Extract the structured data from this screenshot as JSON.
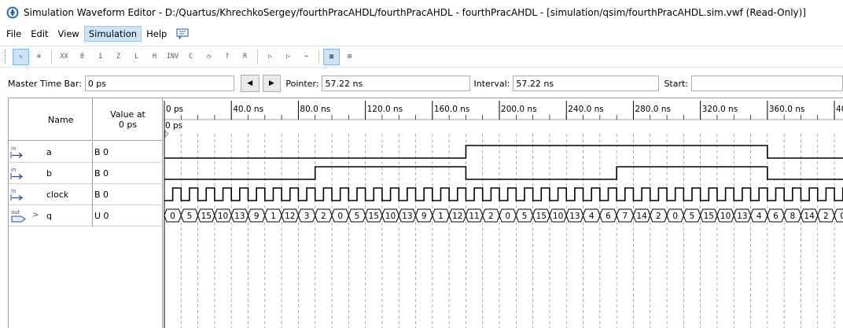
{
  "window": {
    "title": "Simulation Waveform Editor - D:/Quartus/KhrechkoSergey/fourthPracAHDL/fourthPracAHDL - fourthPracAHDL - [simulation/qsim/fourthPracAHDL.sim.vwf (Read-Only)]"
  },
  "menu": {
    "items": [
      "File",
      "Edit",
      "View",
      "Simulation",
      "Help"
    ],
    "active": "Simulation"
  },
  "toolbar": {
    "buttons": [
      {
        "icon": "selection-pointer-icon",
        "glyph": "↖",
        "pressed": true
      },
      {
        "icon": "zoom-icon",
        "glyph": "⊕",
        "pressed": false
      },
      {
        "sep": true
      },
      {
        "icon": "force-unknown-icon",
        "glyph": "XX",
        "pressed": false
      },
      {
        "icon": "force-low-icon",
        "glyph": "0",
        "pressed": false
      },
      {
        "icon": "force-high-icon",
        "glyph": "1",
        "pressed": false
      },
      {
        "icon": "force-high-impedance-icon",
        "glyph": "Z",
        "pressed": false
      },
      {
        "icon": "force-weak-low-icon",
        "glyph": "L",
        "pressed": false
      },
      {
        "icon": "force-weak-high-icon",
        "glyph": "H",
        "pressed": false
      },
      {
        "icon": "invert-icon",
        "glyph": "INV",
        "pressed": false
      },
      {
        "icon": "count-value-icon",
        "glyph": "C",
        "pressed": false
      },
      {
        "icon": "overwrite-clock-icon",
        "glyph": "◷",
        "pressed": false
      },
      {
        "icon": "arbitrary-value-icon",
        "glyph": "?",
        "pressed": false
      },
      {
        "icon": "random-values-icon",
        "glyph": "R",
        "pressed": false
      },
      {
        "sep": true
      },
      {
        "icon": "run-functional-simulation-icon",
        "glyph": "▷",
        "pressed": false
      },
      {
        "icon": "run-timing-simulation-icon",
        "glyph": "▷",
        "pressed": false
      },
      {
        "icon": "generate-netlist-icon",
        "glyph": "⋯",
        "pressed": false
      },
      {
        "sep": true
      },
      {
        "icon": "snap-to-grid-icon",
        "glyph": "▦",
        "pressed": true
      },
      {
        "icon": "snap-to-transition-icon",
        "glyph": "⊞",
        "pressed": false
      }
    ]
  },
  "timebar": {
    "master_label": "Master Time Bar:",
    "master_value": "0 ps",
    "pointer_label": "Pointer:",
    "pointer_value": "57.22 ns",
    "interval_label": "Interval:",
    "interval_value": "57.22 ns",
    "start_label": "Start:",
    "start_value": ""
  },
  "grid": {
    "name_header": "Name",
    "value_header_line1": "Value at",
    "value_header_line2": "0 ps",
    "master_marker": "0 ps"
  },
  "time_axis": {
    "unit": "ns",
    "ticks": [
      "0 ps",
      "40.0 ns",
      "80.0 ns",
      "120.0 ns",
      "160.0 ns",
      "200.0 ns",
      "240.0 ns",
      "280.0 ns",
      "320.0 ns",
      "360.0 ns",
      "400.0 ns"
    ],
    "tick_values_ns": [
      0,
      40,
      80,
      120,
      160,
      200,
      240,
      280,
      320,
      360,
      400
    ],
    "view_start_ns": 0,
    "view_end_ns": 405
  },
  "signals": [
    {
      "name": "a",
      "value": "B 0",
      "direction": "in",
      "icon": "input-pin-icon",
      "type": "bit",
      "transitions_ns": [
        [
          0,
          0
        ],
        [
          180,
          1
        ],
        [
          360,
          0
        ]
      ]
    },
    {
      "name": "b",
      "value": "B 0",
      "direction": "in",
      "icon": "input-pin-icon",
      "type": "bit",
      "transitions_ns": [
        [
          0,
          0
        ],
        [
          90,
          1
        ],
        [
          180,
          0
        ],
        [
          270,
          1
        ],
        [
          360,
          0
        ]
      ]
    },
    {
      "name": "clock",
      "value": "B 0",
      "direction": "in",
      "icon": "input-pin-icon",
      "type": "clock",
      "period_ns": 10
    },
    {
      "name": "q",
      "value": "U 0",
      "direction": "out",
      "icon": "output-pin-icon",
      "type": "bus",
      "expandable": true,
      "bus_period_ns": 10,
      "bus_values": [
        "0",
        "5",
        "15",
        "10",
        "13",
        "9",
        "1",
        "12",
        "3",
        "2",
        "0",
        "5",
        "15",
        "10",
        "13",
        "9",
        "1",
        "12",
        "11",
        "2",
        "0",
        "5",
        "15",
        "10",
        "13",
        "4",
        "6",
        "7",
        "14",
        "2",
        "0",
        "5",
        "15",
        "10",
        "13",
        "4",
        "6",
        "8",
        "14",
        "2",
        "0"
      ]
    }
  ],
  "colors": {
    "accent": "#cce4f7",
    "grid_line": "#9a9a9a",
    "waveform": "#000000"
  }
}
